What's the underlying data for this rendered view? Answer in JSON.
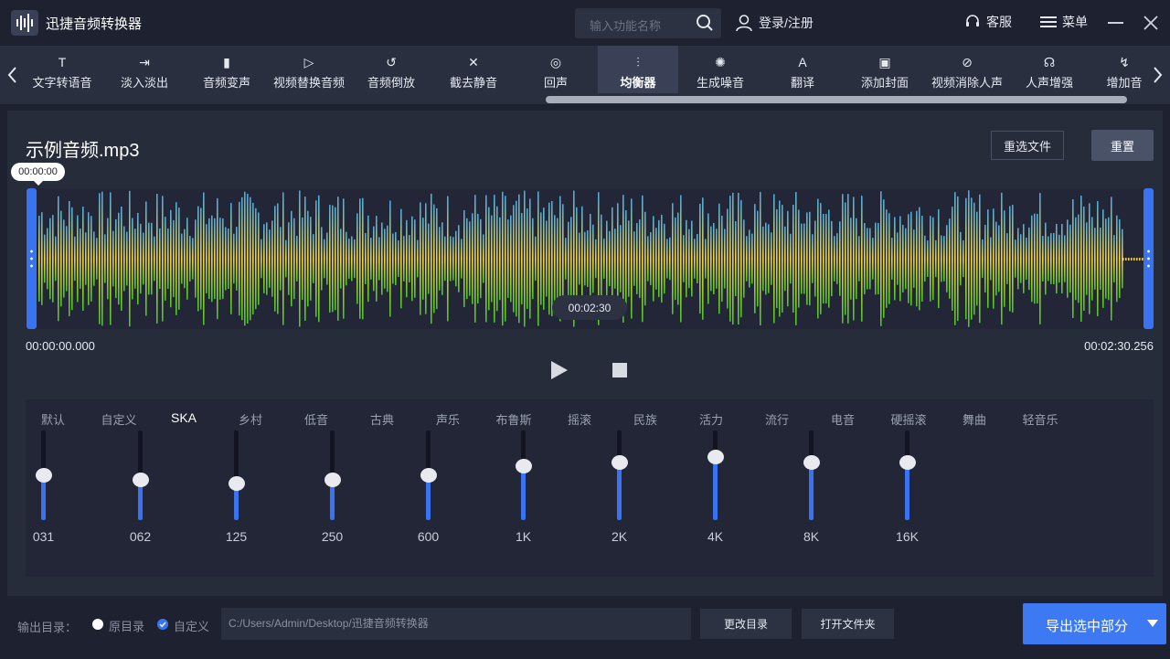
{
  "app": {
    "title": "迅捷音频转换器",
    "search_placeholder": "输入功能名称",
    "login_label": "登录/注册",
    "service_label": "客服",
    "menu_label": "菜单"
  },
  "toolbar": {
    "items": [
      {
        "label": "文字转语音",
        "icon": "text-to-speech-icon"
      },
      {
        "label": "淡入淡出",
        "icon": "fade-icon"
      },
      {
        "label": "音频变声",
        "icon": "voice-change-icon"
      },
      {
        "label": "视频替换音频",
        "icon": "video-audio-icon"
      },
      {
        "label": "音频倒放",
        "icon": "reverse-icon"
      },
      {
        "label": "截去静音",
        "icon": "mute-cut-icon"
      },
      {
        "label": "回声",
        "icon": "echo-icon"
      },
      {
        "label": "均衡器",
        "icon": "equalizer-icon",
        "active": true
      },
      {
        "label": "生成噪音",
        "icon": "noise-icon"
      },
      {
        "label": "翻译",
        "icon": "translate-icon"
      },
      {
        "label": "添加封面",
        "icon": "cover-icon"
      },
      {
        "label": "视频消除人声",
        "icon": "remove-vocal-icon"
      },
      {
        "label": "人声增强",
        "icon": "vocal-enhance-icon"
      },
      {
        "label": "增加音",
        "icon": "add-audio-icon"
      }
    ]
  },
  "file": {
    "name": "示例音频.mp3",
    "reselect_label": "重选文件",
    "reset_label": "重置"
  },
  "player": {
    "cursor_time": "00:00:00",
    "mid_time": "00:02:30",
    "start_time": "00:00:00.000",
    "end_time": "00:02:30.256"
  },
  "colors": {
    "accent": "#3d79f2",
    "wave_top": "#4fa8d8",
    "wave_mid": "#f2d43a",
    "wave_bottom": "#4cc22a"
  },
  "eq": {
    "presets": [
      "默认",
      "自定义",
      "SKA",
      "乡村",
      "低音",
      "古典",
      "声乐",
      "布鲁斯",
      "摇滚",
      "民族",
      "活力",
      "流行",
      "电音",
      "硬摇滚",
      "舞曲",
      "轻音乐"
    ],
    "selected_preset": "SKA",
    "bands": [
      {
        "freq": "031",
        "level": 0.5
      },
      {
        "freq": "062",
        "level": 0.45
      },
      {
        "freq": "125",
        "level": 0.41
      },
      {
        "freq": "250",
        "level": 0.45
      },
      {
        "freq": "600",
        "level": 0.5
      },
      {
        "freq": "1K",
        "level": 0.6
      },
      {
        "freq": "2K",
        "level": 0.64
      },
      {
        "freq": "4K",
        "level": 0.7
      },
      {
        "freq": "8K",
        "level": 0.64
      },
      {
        "freq": "16K",
        "level": 0.64
      }
    ]
  },
  "footer": {
    "output_label": "输出目录：",
    "option_original": "原目录",
    "option_custom": "自定义",
    "selected_option": "自定义",
    "path": "C:/Users/Admin/Desktop/迅捷音频转换器",
    "change_dir_label": "更改目录",
    "open_folder_label": "打开文件夹",
    "export_label": "导出选中部分"
  }
}
